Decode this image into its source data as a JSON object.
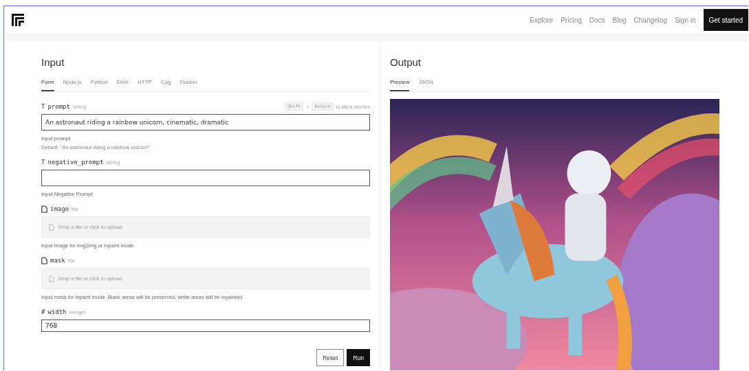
{
  "nav": {
    "links": [
      "Explore",
      "Pricing",
      "Docs",
      "Blog",
      "Changelog",
      "Sign in"
    ],
    "cta": "Get started"
  },
  "input": {
    "title": "Input",
    "tabs": [
      {
        "label": "Form",
        "selected": true
      },
      {
        "label": "Node.js",
        "selected": false
      },
      {
        "label": "Python",
        "selected": false
      },
      {
        "label": "Elixir",
        "selected": false
      },
      {
        "label": "HTTP",
        "selected": false
      },
      {
        "label": "Cog",
        "selected": false
      },
      {
        "label": "Docker",
        "selected": false
      }
    ],
    "fields": [
      {
        "kind": "text",
        "icon": "T",
        "name": "prompt",
        "type": "string",
        "hint_keys": [
          "Shift",
          "+",
          "Return"
        ],
        "hint_text": "to add a new line",
        "value": "An astronaut riding a rainbow unicorn, cinematic, dramatic",
        "help": "Input prompt",
        "default": "Default: \"An astronaut riding a rainbow unicorn\""
      },
      {
        "kind": "text",
        "icon": "T",
        "name": "negative_prompt",
        "type": "string",
        "help": "Input Negative Prompt"
      },
      {
        "kind": "file",
        "name": "image",
        "type": "file",
        "drop": "Drop a file or click to upload",
        "help": "Input image for img2img or inpaint mode"
      },
      {
        "kind": "file",
        "name": "mask",
        "type": "file",
        "drop": "Drop a file or click to upload",
        "help": "Input mask for inpaint mode. Black areas will be preserved, white areas will be inpainted."
      },
      {
        "kind": "number",
        "icon": "#",
        "name": "width",
        "type": "integer",
        "value": "768"
      }
    ],
    "buttons": [
      "Reset",
      "Run"
    ]
  },
  "output": {
    "title": "Output",
    "tabs": [
      {
        "label": "Preview",
        "selected": true
      },
      {
        "label": "JSON",
        "selected": false
      }
    ]
  }
}
